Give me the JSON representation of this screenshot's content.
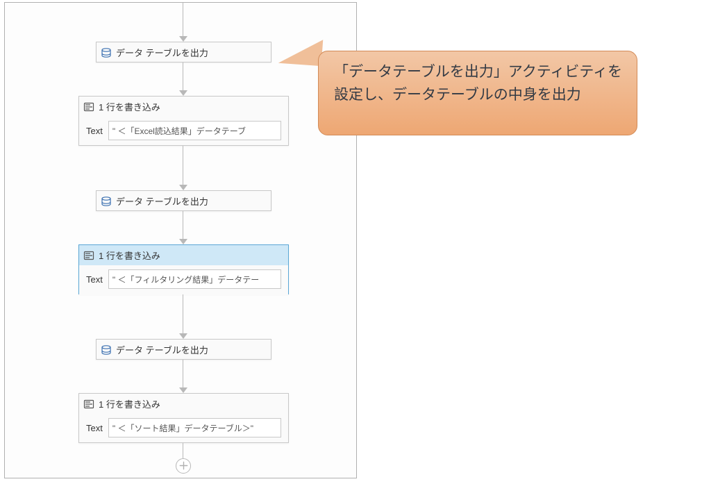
{
  "activities": {
    "output_dt_1": {
      "title": "データ テーブルを出力"
    },
    "write_line_1": {
      "title": "1 行を書き込み",
      "field_label": "Text",
      "field_value": "\" ＜「Excel読込結果」データテーブ"
    },
    "output_dt_2": {
      "title": "データ テーブルを出力"
    },
    "write_line_2": {
      "title": "1 行を書き込み",
      "field_label": "Text",
      "field_value": "\" ＜「フィルタリング結果」データテー"
    },
    "output_dt_3": {
      "title": "データ テーブルを出力"
    },
    "write_line_3": {
      "title": "1 行を書き込み",
      "field_label": "Text",
      "field_value": "\" ＜「ソート結果」データテーブル＞\""
    }
  },
  "callout": {
    "text": "「データテーブルを出力」アクティビティを設定し、データテーブルの中身を出力"
  },
  "add_button": {
    "glyph": "⊕"
  }
}
